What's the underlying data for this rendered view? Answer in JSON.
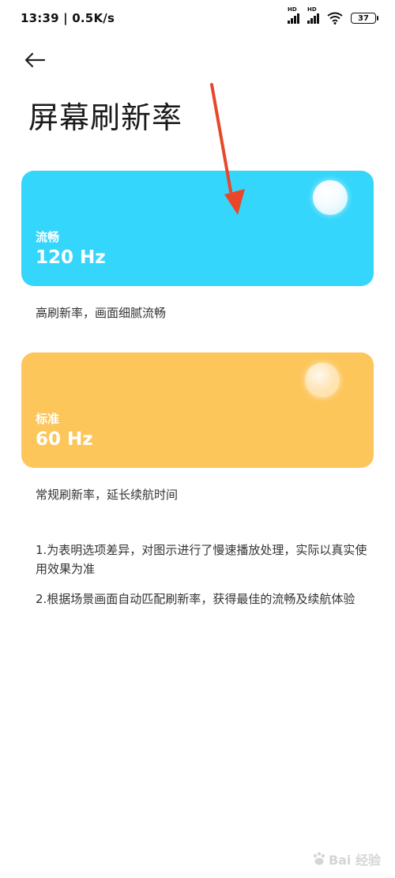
{
  "status_bar": {
    "time_speed": "13:39 | 0.5K/s",
    "signal_1_label": "HD",
    "signal_2_label": "HD",
    "battery_level": "37"
  },
  "header": {
    "back_icon": "arrow-left-icon",
    "title": "屏幕刷新率"
  },
  "options": [
    {
      "name": "流畅",
      "rate": "120 Hz",
      "description": "高刷新率，画面细腻流畅",
      "color": "#35d6fb",
      "selected": true
    },
    {
      "name": "标准",
      "rate": "60 Hz",
      "description": "常规刷新率，延长续航时间",
      "color": "#fdc65a",
      "selected": false
    }
  ],
  "notes": [
    "1.为表明选项差异，对图示进行了慢速播放处理，实际以真实使用效果为准",
    "2.根据场景画面自动匹配刷新率，获得最佳的流畅及续航体验"
  ],
  "annotation_arrow_color": "#e8472a",
  "watermark": {
    "text": "Bai 经验"
  }
}
